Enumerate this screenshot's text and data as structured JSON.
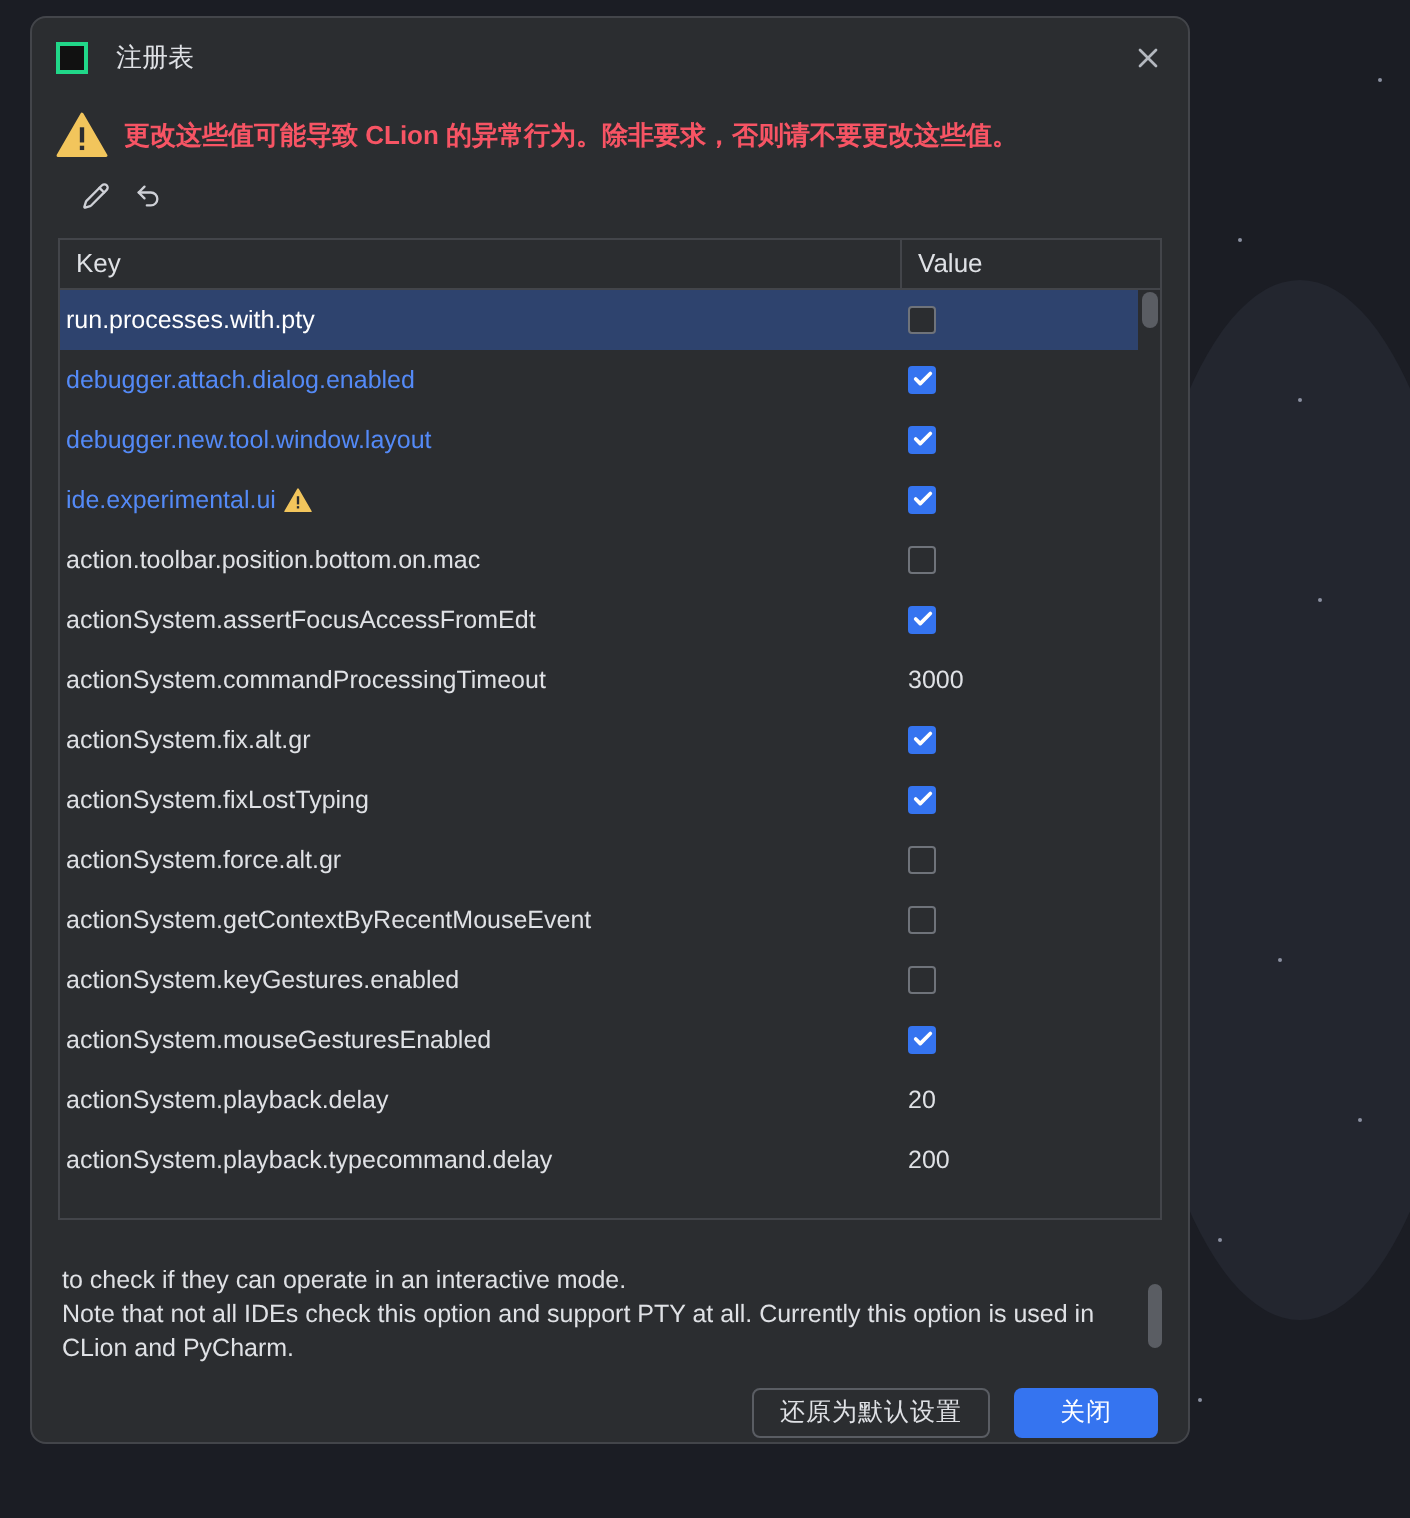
{
  "window": {
    "title": "注册表"
  },
  "warning": "更改这些值可能导致 CLion 的异常行为。除非要求，否则请不要更改这些值。",
  "table": {
    "columns": [
      "Key",
      "Value"
    ],
    "rows": [
      {
        "key": "run.processes.with.pty",
        "kind": "checkbox",
        "checked": false,
        "modified": false,
        "warning": false,
        "selected": true
      },
      {
        "key": "debugger.attach.dialog.enabled",
        "kind": "checkbox",
        "checked": true,
        "modified": true,
        "warning": false,
        "selected": false
      },
      {
        "key": "debugger.new.tool.window.layout",
        "kind": "checkbox",
        "checked": true,
        "modified": true,
        "warning": false,
        "selected": false
      },
      {
        "key": "ide.experimental.ui",
        "kind": "checkbox",
        "checked": true,
        "modified": true,
        "warning": true,
        "selected": false
      },
      {
        "key": "action.toolbar.position.bottom.on.mac",
        "kind": "checkbox",
        "checked": false,
        "modified": false,
        "warning": false,
        "selected": false
      },
      {
        "key": "actionSystem.assertFocusAccessFromEdt",
        "kind": "checkbox",
        "checked": true,
        "modified": false,
        "warning": false,
        "selected": false
      },
      {
        "key": "actionSystem.commandProcessingTimeout",
        "kind": "text",
        "value": "3000",
        "modified": false,
        "warning": false,
        "selected": false
      },
      {
        "key": "actionSystem.fix.alt.gr",
        "kind": "checkbox",
        "checked": true,
        "modified": false,
        "warning": false,
        "selected": false
      },
      {
        "key": "actionSystem.fixLostTyping",
        "kind": "checkbox",
        "checked": true,
        "modified": false,
        "warning": false,
        "selected": false
      },
      {
        "key": "actionSystem.force.alt.gr",
        "kind": "checkbox",
        "checked": false,
        "modified": false,
        "warning": false,
        "selected": false
      },
      {
        "key": "actionSystem.getContextByRecentMouseEvent",
        "kind": "checkbox",
        "checked": false,
        "modified": false,
        "warning": false,
        "selected": false
      },
      {
        "key": "actionSystem.keyGestures.enabled",
        "kind": "checkbox",
        "checked": false,
        "modified": false,
        "warning": false,
        "selected": false
      },
      {
        "key": "actionSystem.mouseGesturesEnabled",
        "kind": "checkbox",
        "checked": true,
        "modified": false,
        "warning": false,
        "selected": false
      },
      {
        "key": "actionSystem.playback.delay",
        "kind": "text",
        "value": "20",
        "modified": false,
        "warning": false,
        "selected": false
      },
      {
        "key": "actionSystem.playback.typecommand.delay",
        "kind": "text",
        "value": "200",
        "modified": false,
        "warning": false,
        "selected": false
      }
    ]
  },
  "description": [
    "to check if they can operate in an interactive mode.",
    "Note that not all IDEs check this option and support PTY at all. Currently this option is used in CLion and PyCharm."
  ],
  "buttons": [
    {
      "label": "还原为默认设置",
      "primary": false
    },
    {
      "label": "关闭",
      "primary": true
    }
  ]
}
